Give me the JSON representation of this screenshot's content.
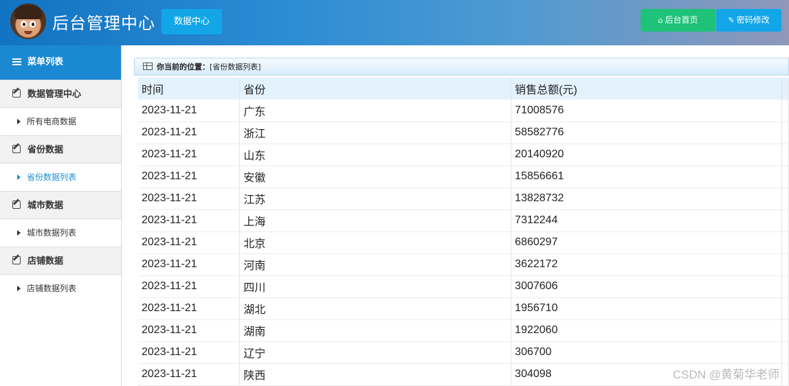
{
  "header": {
    "title": "后台管理中心",
    "data_center_label": "数据中心",
    "home_label": "后台首页",
    "password_label": "密码修改",
    "colors": {
      "home_button": "#1fc279",
      "blue_button": "#12a6e8"
    }
  },
  "sidebar": {
    "menu_title": "菜单列表",
    "groups": [
      {
        "title": "数据管理中心",
        "items": [
          {
            "label": "所有电商数据"
          }
        ]
      },
      {
        "title": "省份数据",
        "items": [
          {
            "label": "省份数据列表",
            "active": true
          }
        ]
      },
      {
        "title": "城市数据",
        "items": [
          {
            "label": "城市数据列表"
          }
        ]
      },
      {
        "title": "店铺数据",
        "items": [
          {
            "label": "店铺数据列表"
          }
        ]
      }
    ]
  },
  "breadcrumb": {
    "prefix": "你当前的位置：",
    "location": "[省份数据列表]"
  },
  "table": {
    "columns": [
      "时间",
      "省份",
      "销售总额(元)"
    ],
    "rows": [
      [
        "2023-11-21",
        "广东",
        "71008576"
      ],
      [
        "2023-11-21",
        "浙江",
        "58582776"
      ],
      [
        "2023-11-21",
        "山东",
        "20140920"
      ],
      [
        "2023-11-21",
        "安徽",
        "15856661"
      ],
      [
        "2023-11-21",
        "江苏",
        "13828732"
      ],
      [
        "2023-11-21",
        "上海",
        "7312244"
      ],
      [
        "2023-11-21",
        "北京",
        "6860297"
      ],
      [
        "2023-11-21",
        "河南",
        "3622172"
      ],
      [
        "2023-11-21",
        "四川",
        "3007606"
      ],
      [
        "2023-11-21",
        "湖北",
        "1956710"
      ],
      [
        "2023-11-21",
        "湖南",
        "1922060"
      ],
      [
        "2023-11-21",
        "辽宁",
        "306700"
      ],
      [
        "2023-11-21",
        "陕西",
        "304098"
      ]
    ]
  },
  "watermark": "CSDN @黄菊华老师"
}
